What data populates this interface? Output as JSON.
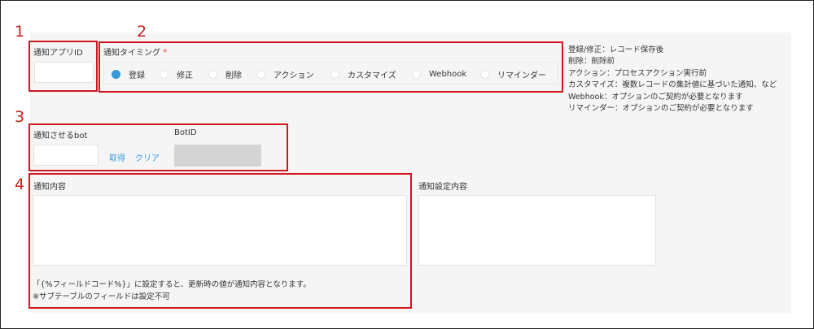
{
  "markers": [
    "1",
    "2",
    "3",
    "4"
  ],
  "app_id": {
    "label": "通知アプリID",
    "value": ""
  },
  "timing": {
    "label": "通知タイミング",
    "required_mark": "*",
    "options": [
      "登録",
      "修正",
      "削除",
      "アクション",
      "カスタマイズ",
      "Webhook",
      "リマインダー"
    ],
    "selected": "登録"
  },
  "timing_notes": [
    "登録/修正：レコード保存後",
    "削除：削除前",
    "アクション：プロセスアクション実行前",
    "カスタマイズ：複数レコードの集計値に基づいた通知、など",
    "Webhook：オプションのご契約が必要となります",
    "リマインダー：オプションのご契約が必要となります"
  ],
  "bot": {
    "label": "通知させるbot",
    "value": "",
    "fetch_label": "取得",
    "clear_label": "クリア",
    "botid_label": "BotID",
    "botid_value": ""
  },
  "content": {
    "label": "通知内容",
    "value": "",
    "hint_lines": [
      "「{%フィールドコード%}」に設定すると、更新時の値が通知内容となります。",
      "※サブテーブルのフィールドは設定不可"
    ]
  },
  "settings": {
    "label": "通知設定内容",
    "value": ""
  },
  "colors": {
    "highlight": "#d0161f",
    "accent": "#3498db",
    "panel": "#f5f5f5"
  }
}
